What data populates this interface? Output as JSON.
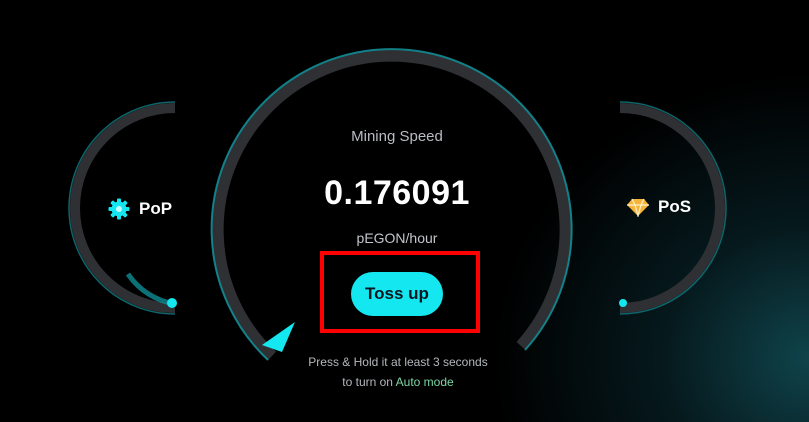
{
  "gauge": {
    "title": "Mining Speed",
    "value": "0.176091",
    "unit": "pEGON/hour"
  },
  "toss_button": {
    "label": "Toss up"
  },
  "hint": {
    "line1": "Press & Hold it at least 3 seconds",
    "line2_prefix": "to turn on",
    "auto_mode": "Auto mode"
  },
  "left_gauge": {
    "label": "PoP",
    "icon": "gear-badge-icon"
  },
  "right_gauge": {
    "label": "PoS",
    "icon": "diamond-icon"
  },
  "colors": {
    "accent": "#14e7ef",
    "track": "#2f3033",
    "highlight": "#ff0000",
    "auto_mode": "#7cd6a6",
    "diamond": "#f5b53a"
  }
}
